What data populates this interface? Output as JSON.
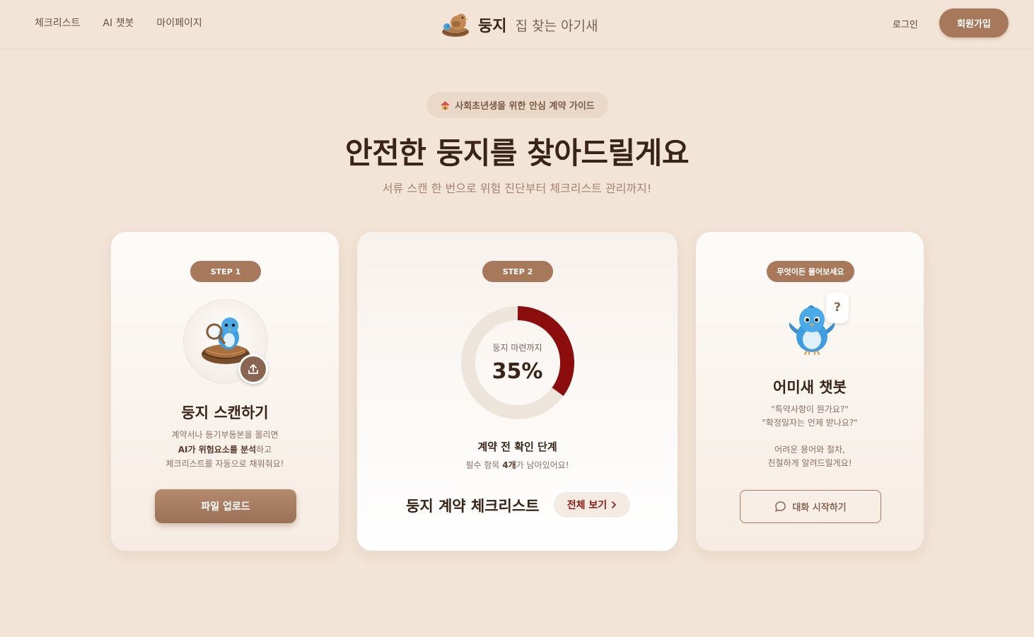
{
  "nav": {
    "items": [
      "체크리스트",
      "AI 챗봇",
      "마이페이지"
    ],
    "brand_name": "둥지",
    "brand_tagline": "집 찾는 아기새",
    "login": "로그인",
    "signup": "회원가입"
  },
  "hero": {
    "badge": "사회초년생을 위한 안심 계약 가이드",
    "badge_icon": "house-icon",
    "title": "안전한 둥지를 찾아드릴게요",
    "subtitle": "서류 스캔 한 번으로 위험 진단부터 체크리스트 관리까지!"
  },
  "card1": {
    "pill": "STEP 1",
    "title": "둥지 스캔하기",
    "desc_line1": "계약서나 등기부등본을 올리면",
    "desc_line2_bold1": "AI가 위험요소를 분석",
    "desc_line2_rest": "하고",
    "desc_line3": "체크리스트를 자동으로 채워줘요!",
    "button": "파일 업로드"
  },
  "card2": {
    "pill": "STEP 2",
    "donut_label": "둥지 마련까지",
    "progress_text": "35%",
    "progress": 0.35,
    "stage_title": "계약 전 확인 단계",
    "stage_sub_pre": "필수 항목 ",
    "stage_sub_bold": "4개",
    "stage_sub_post": "가 남아있어요!",
    "checklist_title": "둥지 계약 체크리스트",
    "view_all": "전체 보기",
    "accent_color": "#8b0d0d"
  },
  "card3": {
    "pill": "무엇이든 물어보세요",
    "bubble": "?",
    "title": "어미새 챗봇",
    "quote1": "\"특약사항이 뭔가요?\"",
    "quote2": "\"확정일자는 언제 받나요?\"",
    "line3": "어려운 용어와 절차,",
    "line4": "친절하게 알려드릴게요!",
    "button": "대화 시작하기"
  }
}
